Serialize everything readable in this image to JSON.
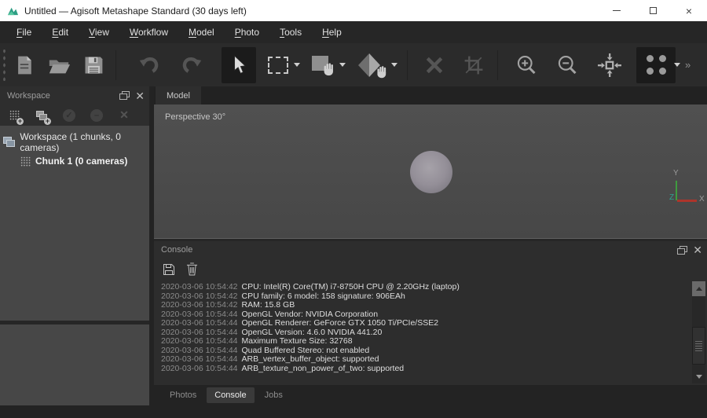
{
  "window": {
    "title": "Untitled — Agisoft Metashape Standard (30 days left)",
    "controls": {
      "minimize": "minimize",
      "maximize": "maximize",
      "close": "close"
    }
  },
  "menu": {
    "items": [
      {
        "first": "F",
        "rest": "ile"
      },
      {
        "first": "E",
        "rest": "dit"
      },
      {
        "first": "V",
        "rest": "iew"
      },
      {
        "first": "W",
        "rest": "orkflow"
      },
      {
        "first": "M",
        "rest": "odel"
      },
      {
        "first": "P",
        "rest": "hoto"
      },
      {
        "first": "T",
        "rest": "ools"
      },
      {
        "first": "H",
        "rest": "elp"
      }
    ]
  },
  "toolbar": {
    "buttons": [
      {
        "icon": "new-document-icon",
        "state": "enabled"
      },
      {
        "icon": "open-folder-icon",
        "state": "enabled"
      },
      {
        "icon": "save-icon",
        "state": "enabled"
      },
      {
        "icon": "undo-icon",
        "state": "disabled"
      },
      {
        "icon": "redo-icon",
        "state": "disabled"
      },
      {
        "icon": "select-arrow-icon",
        "state": "active"
      },
      {
        "icon": "rectangle-selection-icon",
        "state": "enabled",
        "has_dropdown": true
      },
      {
        "icon": "navigation-hand-icon",
        "state": "enabled",
        "has_dropdown": true
      },
      {
        "icon": "rotate-object-icon",
        "state": "enabled",
        "has_dropdown": true
      },
      {
        "icon": "delete-icon",
        "state": "disabled"
      },
      {
        "icon": "crop-icon",
        "state": "disabled"
      },
      {
        "icon": "zoom-in-icon",
        "state": "enabled"
      },
      {
        "icon": "zoom-out-icon",
        "state": "enabled"
      },
      {
        "icon": "fit-to-view-icon",
        "state": "enabled"
      },
      {
        "icon": "point-cloud-display-icon",
        "state": "active",
        "has_dropdown": true
      }
    ],
    "overflow_chevron": "»"
  },
  "workspace": {
    "title": "Workspace",
    "toolbar_icons": [
      "add-chunk-icon",
      "add-photos-icon",
      "enable-icon",
      "disable-icon",
      "remove-icon"
    ],
    "tree": {
      "root_label": "Workspace (1 chunks, 0 cameras)",
      "chunk_label": "Chunk 1 (0 cameras)"
    }
  },
  "viewport": {
    "tab_label": "Model",
    "projection_label": "Perspective 30°",
    "axis_labels": {
      "x": "X",
      "y": "Y",
      "z": "Z"
    },
    "axis_colors": {
      "x": "#ad342b",
      "y": "#3f9b3f",
      "z": "#2fa390"
    }
  },
  "console": {
    "title": "Console",
    "toolbar_icons": [
      "save-log-icon",
      "clear-log-icon"
    ],
    "lines": [
      {
        "time": "2020-03-06 10:54:42",
        "message": "CPU: Intel(R) Core(TM) i7-8750H CPU @ 2.20GHz (laptop)"
      },
      {
        "time": "2020-03-06 10:54:42",
        "message": "CPU family: 6 model: 158 signature: 906EAh"
      },
      {
        "time": "2020-03-06 10:54:42",
        "message": "RAM: 15.8 GB"
      },
      {
        "time": "2020-03-06 10:54:44",
        "message": "OpenGL Vendor: NVIDIA Corporation"
      },
      {
        "time": "2020-03-06 10:54:44",
        "message": "OpenGL Renderer: GeForce GTX 1050 Ti/PCIe/SSE2"
      },
      {
        "time": "2020-03-06 10:54:44",
        "message": "OpenGL Version: 4.6.0 NVIDIA 441.20"
      },
      {
        "time": "2020-03-06 10:54:44",
        "message": "Maximum Texture Size: 32768"
      },
      {
        "time": "2020-03-06 10:54:44",
        "message": "Quad Buffered Stereo: not enabled"
      },
      {
        "time": "2020-03-06 10:54:44",
        "message": "ARB_vertex_buffer_object: supported"
      },
      {
        "time": "2020-03-06 10:54:44",
        "message": "ARB_texture_non_power_of_two: supported"
      }
    ]
  },
  "bottom_tabs": [
    {
      "label": "Photos",
      "active": false
    },
    {
      "label": "Console",
      "active": true
    },
    {
      "label": "Jobs",
      "active": false
    }
  ],
  "colors": {
    "titlebar_bg": "#ffffff",
    "menubar_bg": "#262626",
    "toolbar_bg": "#2b2b2b",
    "panel_bg": "#2e2e2e",
    "tree_bg": "#474747",
    "viewport_bg": "#4c4c4c",
    "app_icon_teal": "#2e9e84"
  }
}
